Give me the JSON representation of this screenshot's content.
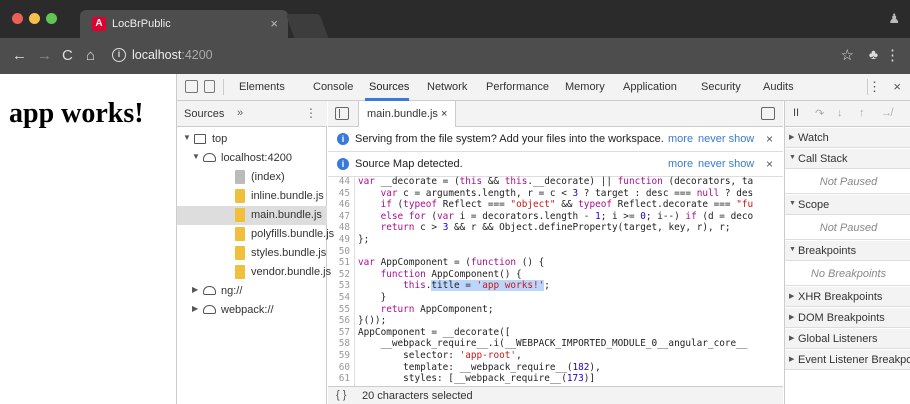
{
  "browser": {
    "tab_title": "LocBrPublic",
    "tab_close": "×",
    "favicon_letter": "A",
    "url_host": "localhost",
    "url_port": ":4200",
    "nav_back": "←",
    "nav_forward": "→",
    "nav_reload": "C",
    "nav_home": "⌂",
    "info": "i",
    "star": "☆",
    "menu": "⋮"
  },
  "page": {
    "heading": "app works!"
  },
  "devtools": {
    "tabs": [
      "Elements",
      "Console",
      "Sources",
      "Network",
      "Performance",
      "Memory",
      "Application",
      "Security",
      "Audits"
    ],
    "active_tab": "Sources",
    "kebab": "⋮",
    "close": "×",
    "navigator": {
      "tab": "Sources",
      "more": "»",
      "kebab": "⋮",
      "tree": [
        {
          "label": "top",
          "type": "frame",
          "expanded": true
        },
        {
          "label": "localhost:4200",
          "type": "cloud",
          "expanded": true
        },
        {
          "label": "(index)",
          "type": "file-grey"
        },
        {
          "label": "inline.bundle.js",
          "type": "file"
        },
        {
          "label": "main.bundle.js",
          "type": "file",
          "selected": true
        },
        {
          "label": "polyfills.bundle.js",
          "type": "file"
        },
        {
          "label": "styles.bundle.js",
          "type": "file"
        },
        {
          "label": "vendor.bundle.js",
          "type": "file"
        },
        {
          "label": "ng://",
          "type": "cloud",
          "expanded": false
        },
        {
          "label": "webpack://",
          "type": "cloud",
          "expanded": false
        }
      ]
    },
    "editor": {
      "file_tab": "main.bundle.js ×",
      "infobars": [
        {
          "text": "Serving from the file system? Add your files into the workspace.",
          "link1": "more",
          "link2": "never show",
          "close": "×"
        },
        {
          "text": "Source Map detected.",
          "link1": "more",
          "link2": "never show",
          "close": "×"
        }
      ],
      "lines": [
        {
          "n": "44",
          "html": "<span class=\"kw\">var</span> __decorate = (<span class=\"kw\">this</span> && <span class=\"kw\">this</span>.__decorate) || <span class=\"kw\">function</span> (decorators, ta"
        },
        {
          "n": "45",
          "html": "    <span class=\"kw\">var</span> c = arguments.length, r = c < <span class=\"num\">3</span> ? target : desc === <span class=\"kw\">null</span> ? des"
        },
        {
          "n": "46",
          "html": "    <span class=\"kw\">if</span> (<span class=\"kw\">typeof</span> Reflect === <span class=\"str\">\"object\"</span> && <span class=\"kw\">typeof</span> Reflect.decorate === <span class=\"str\">\"fu</span>"
        },
        {
          "n": "47",
          "html": "    <span class=\"kw\">else for</span> (<span class=\"kw\">var</span> i = decorators.length - <span class=\"num\">1</span>; i >= <span class=\"num\">0</span>; i--) <span class=\"kw\">if</span> (d = deco"
        },
        {
          "n": "48",
          "html": "    <span class=\"kw\">return</span> c > <span class=\"num\">3</span> && r && Object.defineProperty(target, key, r), r;"
        },
        {
          "n": "49",
          "html": "};"
        },
        {
          "n": "50",
          "html": ""
        },
        {
          "n": "51",
          "html": "<span class=\"kw\">var</span> AppComponent = (<span class=\"kw\">function</span> () {"
        },
        {
          "n": "52",
          "html": "    <span class=\"kw\">function</span> AppComponent() {"
        },
        {
          "n": "53",
          "html": "        <span class=\"kw\">this</span>.<span class=\"sel\">title = <span class=\"str\">'app works!'</span></span>;"
        },
        {
          "n": "54",
          "html": "    }"
        },
        {
          "n": "55",
          "html": "    <span class=\"kw\">return</span> AppComponent;"
        },
        {
          "n": "56",
          "html": "}());"
        },
        {
          "n": "57",
          "html": "AppComponent = __decorate(["
        },
        {
          "n": "58",
          "html": "    __webpack_require__.i(__WEBPACK_IMPORTED_MODULE_0__angular_core__"
        },
        {
          "n": "59",
          "html": "        selector: <span class=\"str\">'app-root'</span>,"
        },
        {
          "n": "60",
          "html": "        template: __webpack_require__(<span class=\"num\">182</span>),"
        },
        {
          "n": "61",
          "html": "        styles: [__webpack_require__(<span class=\"num\">173</span>)]"
        }
      ],
      "status_braces": "{ }",
      "status_text": "20 characters selected"
    },
    "debugger": {
      "controls": [
        "II",
        "↷",
        "↓",
        "↑",
        "↛"
      ],
      "panes": [
        {
          "title": "Watch",
          "expanded": false
        },
        {
          "title": "Call Stack",
          "expanded": true,
          "body": "Not Paused"
        },
        {
          "title": "Scope",
          "expanded": true,
          "body": "Not Paused"
        },
        {
          "title": "Breakpoints",
          "expanded": true,
          "body": "No Breakpoints"
        },
        {
          "title": "XHR Breakpoints",
          "expanded": false
        },
        {
          "title": "DOM Breakpoints",
          "expanded": false
        },
        {
          "title": "Global Listeners",
          "expanded": false
        },
        {
          "title": "Event Listener Breakpoints",
          "expanded": false
        }
      ]
    }
  }
}
